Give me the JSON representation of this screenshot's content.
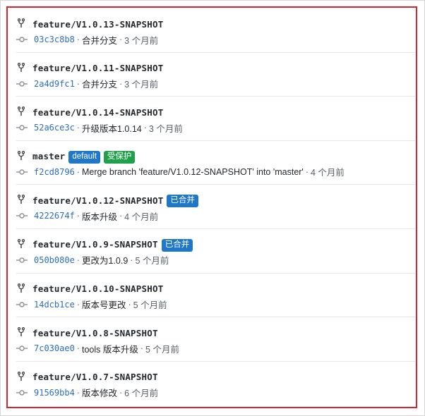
{
  "colors": {
    "highlight_border": "#d9262e",
    "sha_link": "#2c6fbf",
    "badge_blue": "#1f77c9",
    "badge_green": "#20a04a"
  },
  "icons": {
    "branch": "git-branch-icon",
    "commit": "git-commit-icon"
  },
  "separator": "·",
  "branches": [
    {
      "name": "feature/V1.0.13-SNAPSHOT",
      "badges": [],
      "sha": "03c3c8b8",
      "message": "合并分支",
      "time": "3 个月前"
    },
    {
      "name": "feature/V1.0.11-SNAPSHOT",
      "badges": [],
      "sha": "2a4d9fc1",
      "message": "合并分支",
      "time": "3 个月前"
    },
    {
      "name": "feature/V1.0.14-SNAPSHOT",
      "badges": [],
      "sha": "52a6ce3c",
      "message": "升级版本1.0.14",
      "time": "3 个月前"
    },
    {
      "name": "master",
      "badges": [
        {
          "label": "default",
          "color": "blue"
        },
        {
          "label": "受保护",
          "color": "green"
        }
      ],
      "sha": "f2cd8796",
      "message": "Merge branch 'feature/V1.0.12-SNAPSHOT' into 'master'",
      "time": "4 个月前"
    },
    {
      "name": "feature/V1.0.12-SNAPSHOT",
      "badges": [
        {
          "label": "已合并",
          "color": "blue"
        }
      ],
      "sha": "4222674f",
      "message": "版本升级",
      "time": "4 个月前"
    },
    {
      "name": "feature/V1.0.9-SNAPSHOT",
      "badges": [
        {
          "label": "已合并",
          "color": "blue"
        }
      ],
      "sha": "050b080e",
      "message": "更改为1.0.9",
      "time": "5 个月前"
    },
    {
      "name": "feature/V1.0.10-SNAPSHOT",
      "badges": [],
      "sha": "14dcb1ce",
      "message": "版本号更改",
      "time": "5 个月前"
    },
    {
      "name": "feature/V1.0.8-SNAPSHOT",
      "badges": [],
      "sha": "7c030ae0",
      "message": "tools 版本升级",
      "time": "5 个月前"
    },
    {
      "name": "feature/V1.0.7-SNAPSHOT",
      "badges": [],
      "sha": "91569bb4",
      "message": "版本修改",
      "time": "6 个月前"
    }
  ]
}
